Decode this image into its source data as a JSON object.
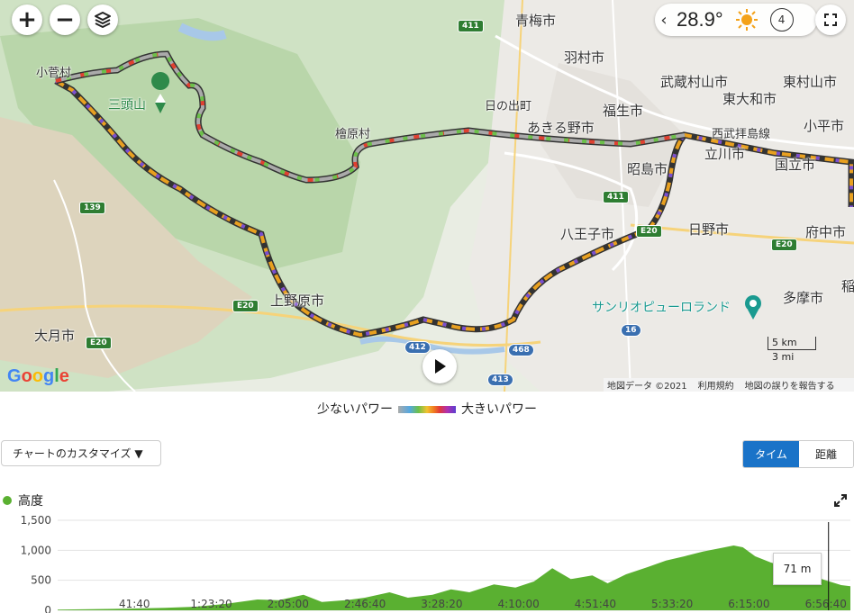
{
  "map": {
    "zoom_in": "+",
    "zoom_out": "−",
    "layers_icon": "layers-icon",
    "weather": {
      "temperature": "28.9°",
      "wind_speed": "4"
    },
    "places": [
      {
        "id": "omekawashi",
        "label": "青梅市"
      },
      {
        "id": "hamura",
        "label": "羽村市"
      },
      {
        "id": "musashimurayama",
        "label": "武蔵村山市"
      },
      {
        "id": "higashiyamato",
        "label": "東大和市"
      },
      {
        "id": "higashimurayama",
        "label": "東村山市"
      },
      {
        "id": "kodaira",
        "label": "小平市"
      },
      {
        "id": "hinodemachi",
        "label": "日の出町"
      },
      {
        "id": "fussa",
        "label": "福生市"
      },
      {
        "id": "akiruno",
        "label": "あきる野市"
      },
      {
        "id": "seibu",
        "label": "西武拝島線"
      },
      {
        "id": "tachikawa",
        "label": "立川市"
      },
      {
        "id": "akishima",
        "label": "昭島市"
      },
      {
        "id": "hinohara",
        "label": "檜原村"
      },
      {
        "id": "kosuge",
        "label": "小菅村"
      },
      {
        "id": "mitouzan",
        "label": "三頭山"
      },
      {
        "id": "hachioji",
        "label": "八王子市"
      },
      {
        "id": "hino",
        "label": "日野市"
      },
      {
        "id": "fuchu",
        "label": "府中市"
      },
      {
        "id": "tama",
        "label": "多摩市"
      },
      {
        "id": "sanrio",
        "label": "サンリオピューロランド"
      },
      {
        "id": "uenohara",
        "label": "上野原市"
      },
      {
        "id": "otsuki",
        "label": "大月市"
      },
      {
        "id": "kunitachi",
        "label": "国立市"
      },
      {
        "id": "inagi",
        "label": "稲"
      }
    ],
    "road_badges": [
      "411",
      "139",
      "411",
      "E20",
      "E20",
      "E20",
      "E20",
      "412",
      "468",
      "413",
      "16"
    ],
    "scale": {
      "km": "5 km",
      "mi": "3 mi"
    },
    "google_logo": "Google",
    "attribution": {
      "data": "地図データ ©2021",
      "terms": "利用規約",
      "report": "地図の誤りを報告する"
    }
  },
  "legend": {
    "low": "少ないパワー",
    "high": "大きいパワー"
  },
  "controls": {
    "customize": "チャートのカスタマイズ ▼",
    "tab_time": "タイム",
    "tab_distance": "距離"
  },
  "chart_data": {
    "type": "area",
    "title": "高度",
    "color": "#5ab031",
    "ylim": [
      0,
      1500
    ],
    "yticks": [
      "1,500",
      "1,000",
      "500",
      "0"
    ],
    "xticks": [
      "41:40",
      "1:23:20",
      "2:05:00",
      "2:46:40",
      "3:28:20",
      "4:10:00",
      "4:51:40",
      "5:33:20",
      "6:15:00",
      "6:56:40"
    ],
    "x_seconds_max": 25800,
    "points": [
      [
        0,
        10
      ],
      [
        2500,
        30
      ],
      [
        3500,
        40
      ],
      [
        4500,
        60
      ],
      [
        5500,
        110
      ],
      [
        6500,
        180
      ],
      [
        7200,
        170
      ],
      [
        8000,
        260
      ],
      [
        8600,
        140
      ],
      [
        9400,
        170
      ],
      [
        10000,
        210
      ],
      [
        10800,
        300
      ],
      [
        11400,
        210
      ],
      [
        12200,
        260
      ],
      [
        12800,
        350
      ],
      [
        13400,
        300
      ],
      [
        14200,
        430
      ],
      [
        14900,
        380
      ],
      [
        15500,
        480
      ],
      [
        16100,
        700
      ],
      [
        16700,
        520
      ],
      [
        17400,
        580
      ],
      [
        17900,
        450
      ],
      [
        18500,
        600
      ],
      [
        19200,
        720
      ],
      [
        19800,
        830
      ],
      [
        20400,
        900
      ],
      [
        21000,
        980
      ],
      [
        21600,
        1040
      ],
      [
        22000,
        1080
      ],
      [
        22300,
        1050
      ],
      [
        22700,
        900
      ],
      [
        23200,
        800
      ],
      [
        23800,
        700
      ],
      [
        24400,
        600
      ],
      [
        25000,
        500
      ],
      [
        25500,
        420
      ],
      [
        25800,
        400
      ]
    ],
    "cursor": {
      "x_label": "6:56:40",
      "value_label": "71 m"
    }
  }
}
